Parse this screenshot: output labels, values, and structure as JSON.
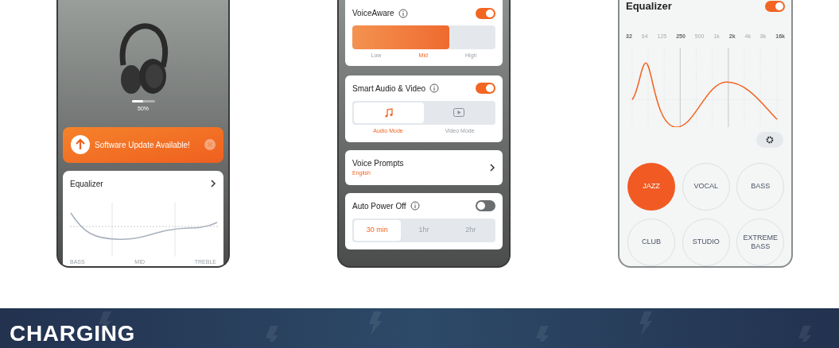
{
  "device_screen": {
    "battery": {
      "level": 0.5,
      "reading": "50%"
    },
    "update_banner": {
      "text": "Software Update Available!"
    },
    "equalizer_card": {
      "title": "Equalizer",
      "band_labels": [
        "BASS",
        "MID",
        "TREBLE"
      ]
    }
  },
  "settings_screen": {
    "voice_aware": {
      "title": "VoiceAware",
      "on": true,
      "level": 0.68,
      "steps": [
        {
          "label": "Low",
          "selected": false
        },
        {
          "label": "Mid",
          "selected": true
        },
        {
          "label": "High",
          "selected": false
        }
      ]
    },
    "smart_audio": {
      "title": "Smart Audio & Video",
      "on": true,
      "modes": [
        {
          "label": "Audio Mode",
          "kind": "audio",
          "selected": true
        },
        {
          "label": "Video Mode",
          "kind": "video",
          "selected": false
        }
      ]
    },
    "voice_prompts": {
      "title": "Voice Prompts",
      "value": "English"
    },
    "auto_power_off": {
      "title": "Auto Power Off",
      "on": false,
      "options": [
        {
          "label": "30 min",
          "selected": true
        },
        {
          "label": "1hr",
          "selected": false
        },
        {
          "label": "2hr",
          "selected": false
        }
      ]
    }
  },
  "equalizer_screen": {
    "title": "Equalizer",
    "on": true,
    "frequencies": [
      {
        "label": "32",
        "bold": true
      },
      {
        "label": "64",
        "bold": false
      },
      {
        "label": "125",
        "bold": false
      },
      {
        "label": "250",
        "bold": true
      },
      {
        "label": "500",
        "bold": false
      },
      {
        "label": "1k",
        "bold": false
      },
      {
        "label": "2k",
        "bold": true
      },
      {
        "label": "4k",
        "bold": false
      },
      {
        "label": "8k",
        "bold": false
      },
      {
        "label": "16k",
        "bold": true
      }
    ],
    "presets": [
      {
        "label": "JAZZ",
        "selected": true
      },
      {
        "label": "VOCAL",
        "selected": false
      },
      {
        "label": "BASS",
        "selected": false
      },
      {
        "label": "CLUB",
        "selected": false
      },
      {
        "label": "STUDIO",
        "selected": false
      },
      {
        "label": "EXTREME BASS",
        "selected": false
      }
    ]
  },
  "banner": {
    "title": "CHARGING"
  }
}
